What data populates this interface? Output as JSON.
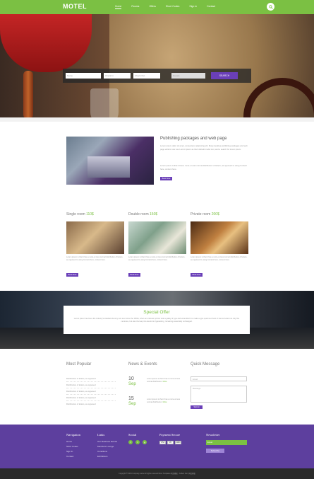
{
  "header": {
    "logo": "MOTEL",
    "nav": [
      "Home",
      "Rooms",
      "Offers",
      "Short Codes",
      "Sign in",
      "Contact"
    ]
  },
  "booking": {
    "name_placeholder": "Name",
    "date1": "Check In",
    "date2": "Check Out",
    "guests": "Guests",
    "search_label": "SEARCH"
  },
  "publishing": {
    "title": "Publishing packages and web page",
    "text1": "Lorem ipsum dolor sit amet, consectetur adipiscing elit. Many desktop publishing packages and web page editors now use Lorem Ipsum as their default model text, and a search for lorem ipsum.",
    "text2": "Lorem ipsum is that it has a more-or-less normal distribution of letters, as opposed to using Content here, content here.",
    "button": "Book Now"
  },
  "rooms": [
    {
      "title": "Single room",
      "price": "110$",
      "text": "Lorem ipsum is that it has a more-or-less normal distribution of letters, as opposed to using Content here, content here.",
      "button": "Book Now"
    },
    {
      "title": "Double room",
      "price": "150$",
      "text": "Lorem ipsum is that it has a more-or-less normal distribution of letters, as opposed to using Content here, content here.",
      "button": "Book Now"
    },
    {
      "title": "Private room",
      "price": "200$",
      "text": "Lorem ipsum is that it has a more-or-less normal distribution of letters, as opposed to using Content here, content here.",
      "button": "Book Now"
    }
  ],
  "offer": {
    "title": "Special Offer",
    "text": "Lorem ipsum has been the industry's standard dummy text ever since the 1500s, when an unknown printer took a galley of type and scrambled it to make a type specimen book. It has survived not only five centuries, but also the leap into electronic typesetting, remaining essentially unchanged."
  },
  "most_popular": {
    "title": "Most Popular",
    "items": [
      "Distribution of letters, as opposed",
      "Distribution of letters, as opposed",
      "Distribution of letters, as opposed",
      "Distribution of letters, as opposed",
      "Distribution of letters, as opposed"
    ]
  },
  "news": {
    "title": "News & Events",
    "events": [
      {
        "day": "10",
        "month": "Sep",
        "text": "Lorem ipsum is that it has a more-or-less normal distribution.",
        "more": "More"
      },
      {
        "day": "15",
        "month": "Sep",
        "text": "Lorem ipsum is that it has a more-or-less normal distribution.",
        "more": "More"
      }
    ]
  },
  "quick_message": {
    "title": "Quick Message",
    "email_placeholder": "Email",
    "message_placeholder": "Message",
    "submit": "Submit"
  },
  "footer": {
    "navigation": {
      "title": "Navigation",
      "links": [
        "Home",
        "Short Codes",
        "Sign In",
        "Contact"
      ]
    },
    "links": {
      "title": "Links",
      "links": [
        "Our Business Events",
        "Members Lounge",
        "Conditions",
        "Exhibitions"
      ]
    },
    "social": {
      "title": "Social",
      "icons": [
        "f",
        "t",
        "g"
      ]
    },
    "payment": {
      "title": "Payment Secure",
      "cards": [
        "VISA",
        "MC",
        "AMEX"
      ]
    },
    "newsletter": {
      "title": "Newsletter",
      "placeholder": "Email",
      "button": "Subscribe"
    },
    "copyright": "Copyright © 2015 Company name All rights reserved More Templates 网页模板 - Collect from 网页模板"
  }
}
